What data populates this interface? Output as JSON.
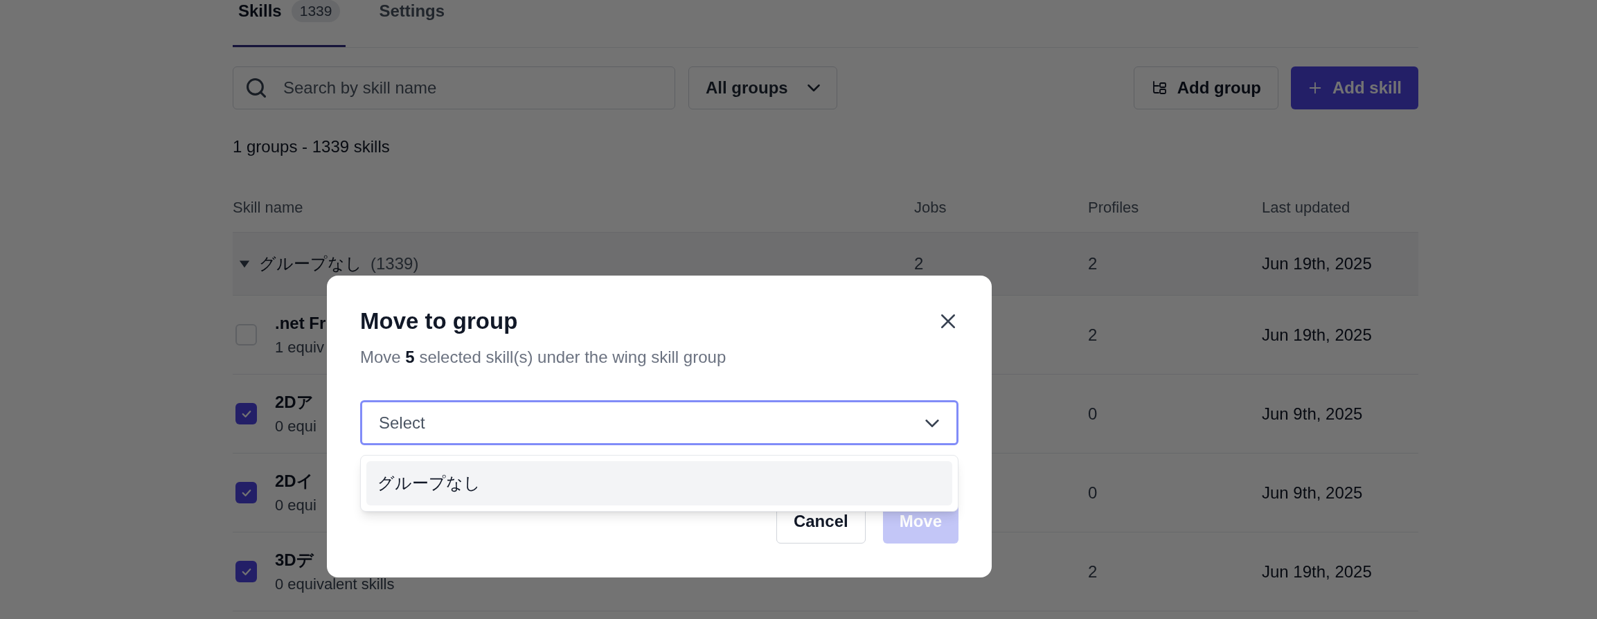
{
  "tabs": [
    {
      "label": "Skills",
      "count": "1339",
      "selected": true
    },
    {
      "label": "Settings",
      "selected": false
    }
  ],
  "toolbar": {
    "search": {
      "placeholder": "Search by skill name"
    },
    "group_filter": "All groups",
    "buttons": [
      {
        "label": "Add group",
        "kind": "secondary"
      },
      {
        "label": "Add skill",
        "kind": "primary"
      }
    ]
  },
  "summary": "1 groups - 1339 skills",
  "table": {
    "columns": [
      "Skill name",
      "Jobs",
      "Profiles",
      "Last updated"
    ],
    "group": {
      "name": "グループなし",
      "count": "(1339)",
      "expanded": true,
      "jobs": "2",
      "profiles": "2",
      "updated": "Jun 19th, 2025"
    },
    "rows": [
      {
        "name": ".net Fr",
        "equivalents": "1 equiv",
        "checked": false,
        "profiles": "2",
        "updated": "Jun 19th, 2025"
      },
      {
        "name": "2Dア",
        "equivalents": "0 equi",
        "checked": true,
        "profiles": "0",
        "updated": "Jun 9th, 2025"
      },
      {
        "name": "2Dイ",
        "equivalents": "0 equi",
        "checked": true,
        "profiles": "0",
        "updated": "Jun 9th, 2025"
      },
      {
        "name": "3Dデ",
        "equivalents": "0 equivalent skills",
        "checked": true,
        "profiles": "2",
        "updated": "Jun 19th, 2025"
      }
    ]
  },
  "dialog": {
    "title": "Move to group",
    "description": "Move **5** selected skill(s) under the wing skill group",
    "select": {
      "placeholder": "Select",
      "expanded": true,
      "options": [
        {
          "label": "グループなし",
          "highlighted": true
        }
      ]
    },
    "buttons": [
      {
        "label": "Cancel",
        "kind": "secondary",
        "disabled": false
      },
      {
        "label": "Move",
        "kind": "primary",
        "disabled": true
      }
    ]
  }
}
